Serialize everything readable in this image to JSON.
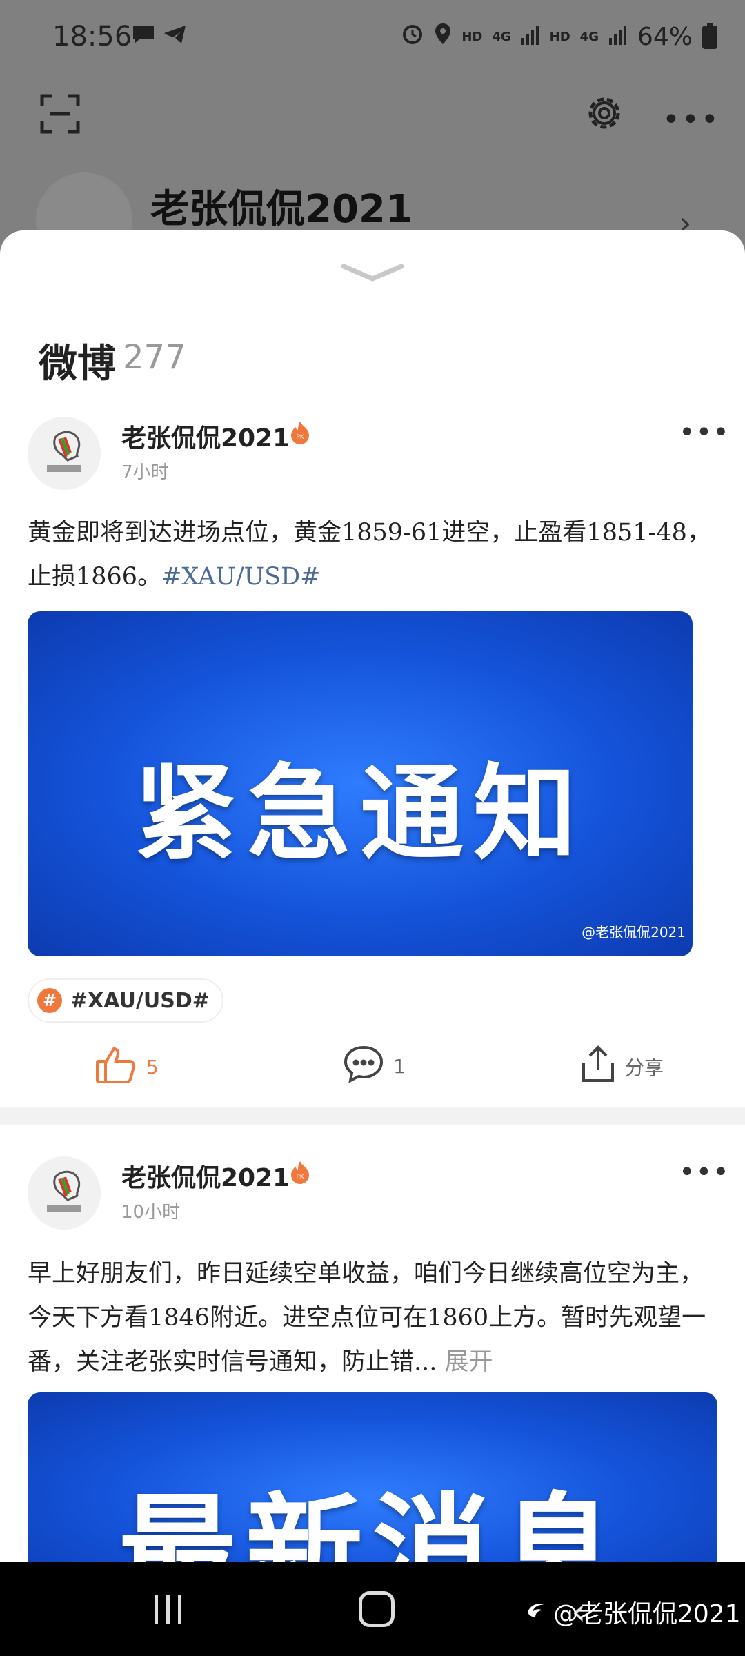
{
  "status_bar": {
    "time": "18:56",
    "battery": "64%",
    "hd1": "HD",
    "net1": "4G",
    "hd2": "HD",
    "net2": "4G",
    "battery_level": "7"
  },
  "profile": {
    "name": "老张侃侃2021"
  },
  "sheet": {
    "title": "微博",
    "count": "277"
  },
  "posts": [
    {
      "author": "老张侃侃2021",
      "badge": "PK",
      "time": "7小时",
      "text": "黄金即将到达进场点位，黄金1859-61进空，止盈看1851-48，止损1866。",
      "tag": "#XAU/USD#",
      "image_text": "紧急通知",
      "image_watermark": "@老张侃侃2021",
      "topic": "#XAU/USD#",
      "likes": "5",
      "comments": "1",
      "share": "分享"
    },
    {
      "author": "老张侃侃2021",
      "badge": "PK",
      "time": "10小时",
      "text": "早上好朋友们，昨日延续空单收益，咱们今日继续高位空为主，今天下方看1846附近。进空点位可在1860上方。暂时先观望一番，关注老张实时信号通知，防止错...",
      "expand": "展开",
      "image_text": "最新消息"
    }
  ],
  "watermark": "@老张侃侃2021",
  "colors": {
    "accent": "#f0783c",
    "topic_link": "#4a6a97",
    "banner_blue": "#1453d9"
  }
}
